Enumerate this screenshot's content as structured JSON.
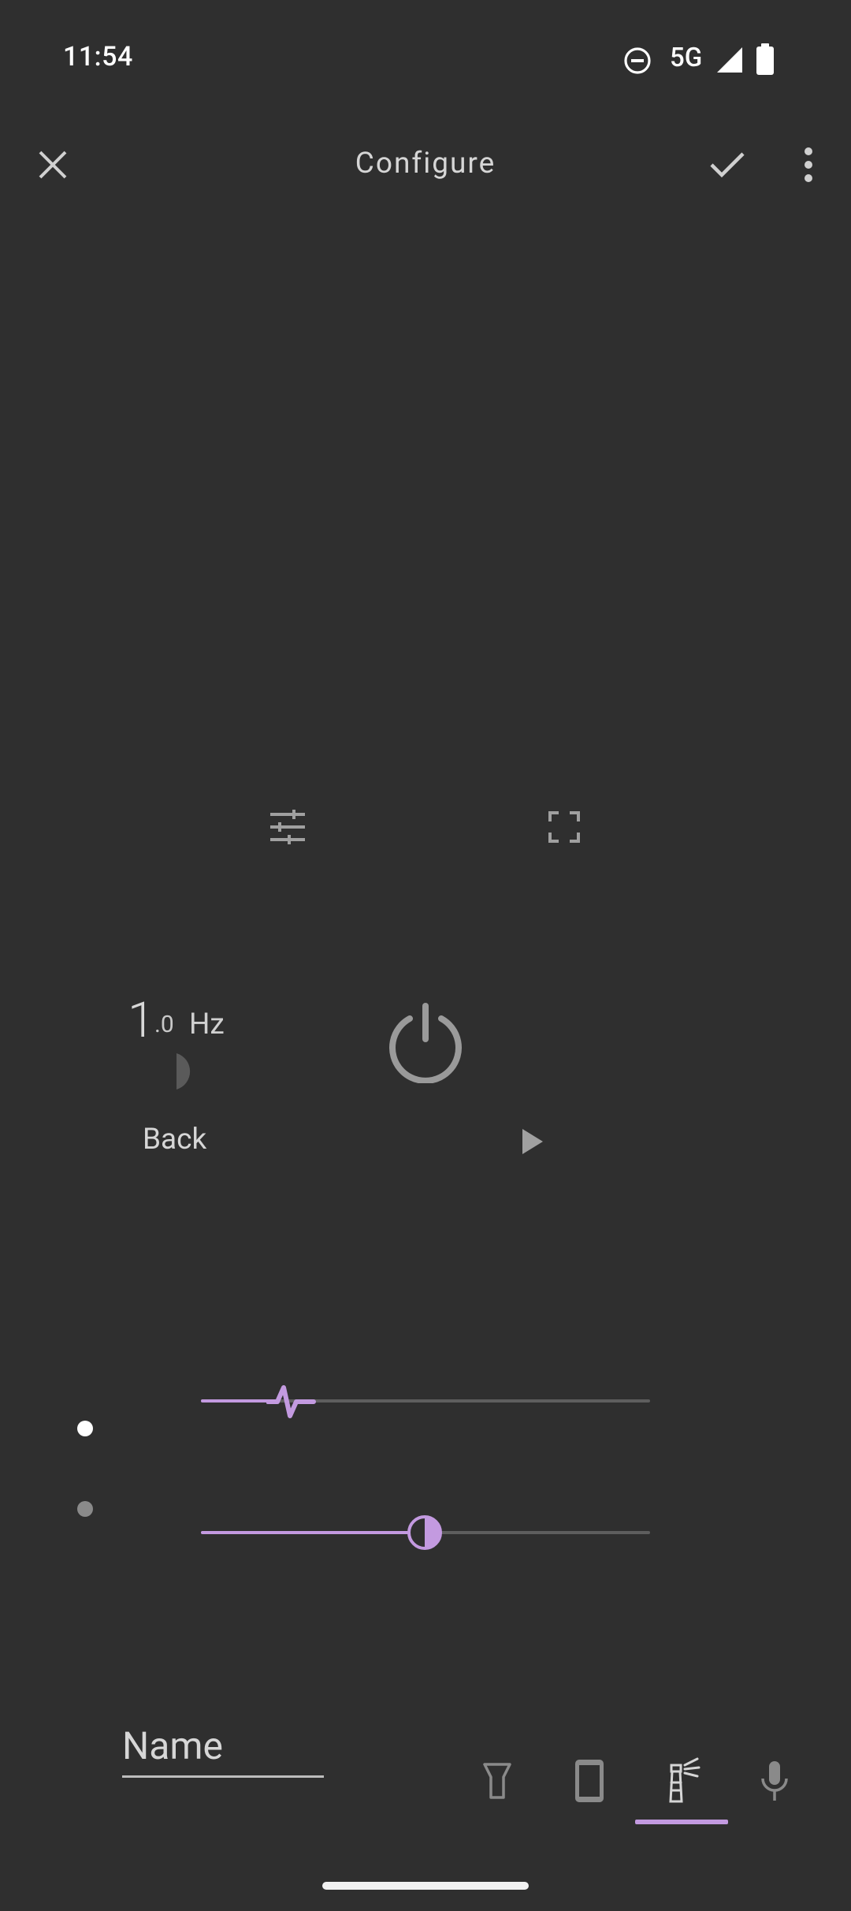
{
  "status_bar": {
    "time": "11:54",
    "network": "5G",
    "icons": [
      "do-not-disturb-icon",
      "signal-icon",
      "battery-icon"
    ]
  },
  "top_bar": {
    "title": "Configure",
    "icons": [
      "close-icon",
      "check-icon",
      "more-vert-icon"
    ]
  },
  "toolbar_mid": {
    "icons": [
      "tune-icon",
      "fullscreen-icon"
    ]
  },
  "frequency": {
    "whole": "1",
    "fraction": ".0",
    "unit": "Hz"
  },
  "controls": {
    "back_label": "Back",
    "icons": [
      "half-circle-icon",
      "power-icon",
      "play-icon"
    ]
  },
  "sliders": [
    {
      "name": "waveform-slider",
      "value": 0.2
    },
    {
      "name": "brightness-slider",
      "value": 0.5
    }
  ],
  "bottom": {
    "name_label": "Name",
    "tabs": [
      "flashlight-tab",
      "screen-tab",
      "beacon-tab",
      "microphone-tab"
    ],
    "selected_tab": "beacon-tab"
  },
  "colors": {
    "accent": "#c39ae0",
    "background": "#2f2f2f"
  }
}
